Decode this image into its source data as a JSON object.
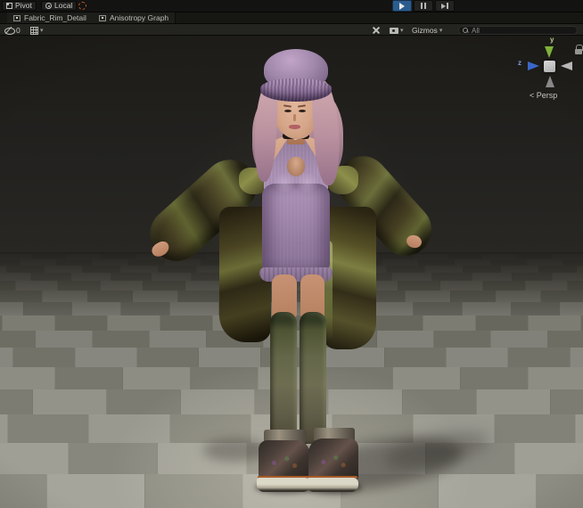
{
  "top_toolbar": {
    "pivot_label": "Pivot",
    "local_label": "Local"
  },
  "tabs": [
    {
      "label": "Fabric_Rim_Detail"
    },
    {
      "label": "Anisotropy Graph"
    }
  ],
  "scene_toolbar": {
    "hidden_count": "0",
    "gizmos_label": "Gizmos",
    "search_value": "All"
  },
  "viewport": {
    "axis_y": "y",
    "axis_z": "z",
    "projection": "< Persp"
  },
  "icons": {
    "dropdown": "▾"
  },
  "colors": {
    "play_active": "#2b5c8e",
    "floor_light_near": "#a6a59c",
    "floor_dark_near": "#8e8d83",
    "floor_light_far": "#56554d",
    "floor_dark_far": "#45443c",
    "hat": "#a289ad",
    "dress": "#a88fb2",
    "jacket": "#4a4426",
    "stockings": "#5c6144",
    "hair": "#c299a3",
    "skin": "#cf9c80",
    "boots": "#3a332e"
  }
}
